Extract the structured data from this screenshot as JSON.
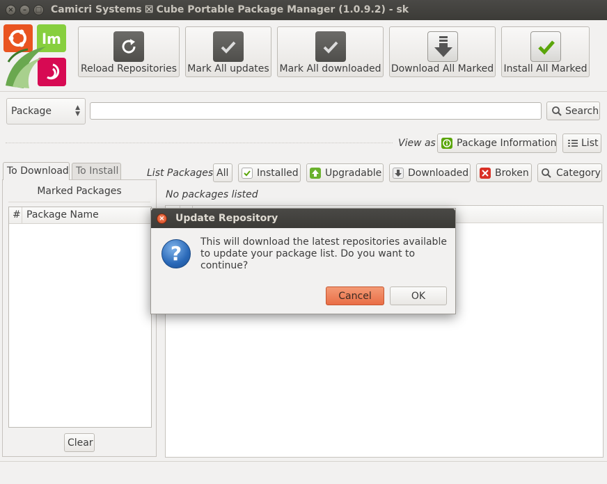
{
  "window": {
    "title": "Camicri Systems ⮽ Cube Portable Package Manager (1.0.9.2) - sk"
  },
  "toolbar": {
    "reload_label": "Reload Repositories",
    "mark_updates_label": "Mark All updates",
    "mark_downloaded_label": "Mark All downloaded",
    "download_marked_label": "Download All Marked",
    "install_marked_label": "Install All Marked"
  },
  "search": {
    "scope_value": "Package",
    "query_value": "",
    "button_label": "Search"
  },
  "view": {
    "label": "View as",
    "package_info_label": "Package Information",
    "list_label": "List"
  },
  "tabs": [
    {
      "label": "To Download",
      "active": true
    },
    {
      "label": "To Install",
      "active": false
    }
  ],
  "left_panel": {
    "title": "Marked Packages",
    "columns": [
      "#",
      "Package Name"
    ],
    "clear_label": "Clear"
  },
  "filters": {
    "label": "List Packages",
    "all": "All",
    "installed": "Installed",
    "upgradable": "Upgradable",
    "downloaded": "Downloaded",
    "broken": "Broken",
    "category": "Category"
  },
  "package_list": {
    "status": "No packages listed"
  },
  "dialog": {
    "title": "Update Repository",
    "message_line1": "This will download the latest repositories available",
    "message_line2": "to update your package list. Do you want to continue?",
    "cancel_label": "Cancel",
    "ok_label": "OK"
  },
  "colors": {
    "titlebar": "#3c3b37",
    "close_button": "#e9582c",
    "accent_green": "#5aa50a",
    "ubuntu_orange": "#e95420",
    "mint_green": "#87cf3e",
    "debian_red": "#d70a53"
  }
}
